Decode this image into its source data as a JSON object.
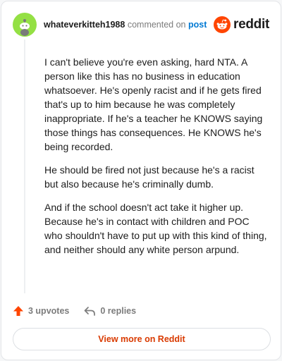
{
  "header": {
    "username": "whateverkitteh1988",
    "action_text": "commented on",
    "post_link": "post",
    "brand": "reddit"
  },
  "comment": {
    "paragraphs": [
      "I can't believe you're even asking, hard NTA. A person like this has no business in education whatsoever. He's openly racist and if he gets fired that's up to him because he was completely inappropriate. If he's a teacher he KNOWS saying those things has consequences. He KNOWS he's being recorded.",
      "He should be fired not just because he's a racist but also because he's criminally dumb.",
      "And if the school doesn't act take it higher up. Because he's in contact with children and POC who shouldn't have to put up with this kind of thing, and neither should any white person arpund."
    ]
  },
  "actions": {
    "upvotes": "3 upvotes",
    "replies": "0 replies"
  },
  "footer": {
    "view_label": "View more on Reddit"
  },
  "colors": {
    "avatar_bg": "#94e044",
    "reddit_orange": "#ff4500",
    "upvote": "#ff4500",
    "link_blue": "#0079d3",
    "view_button_text": "#d93a00"
  },
  "icons": {
    "avatar": "snoo-avatar-icon",
    "brand": "reddit-logo-icon",
    "upvote": "upvote-arrow-icon",
    "reply": "reply-arrow-icon"
  }
}
